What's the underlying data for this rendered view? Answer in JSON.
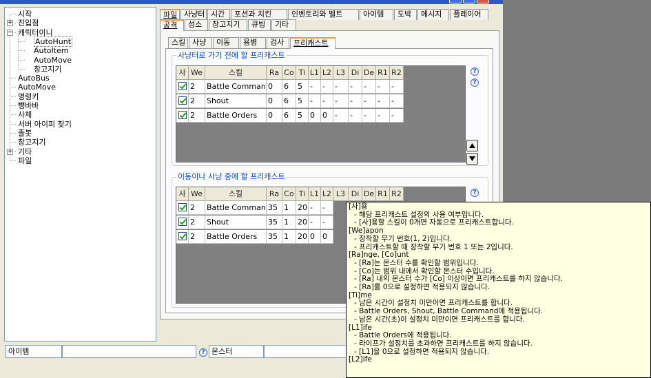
{
  "tree": {
    "items": [
      {
        "label": "시작",
        "level": 0,
        "exp": ""
      },
      {
        "label": "진입점",
        "level": 0,
        "exp": "+"
      },
      {
        "label": "캐릭터이니",
        "level": 0,
        "exp": "-"
      },
      {
        "label": "AutoHunt",
        "level": 1,
        "exp": "",
        "selected": true
      },
      {
        "label": "AutoItem",
        "level": 1,
        "exp": ""
      },
      {
        "label": "AutoMove",
        "level": 1,
        "exp": ""
      },
      {
        "label": "창고지기",
        "level": 1,
        "exp": ""
      },
      {
        "label": "AutoBus",
        "level": 0,
        "exp": ""
      },
      {
        "label": "AutoMove",
        "level": 0,
        "exp": ""
      },
      {
        "label": "명령키",
        "level": 0,
        "exp": ""
      },
      {
        "label": "뺑바바",
        "level": 0,
        "exp": ""
      },
      {
        "label": "사체",
        "level": 0,
        "exp": ""
      },
      {
        "label": "서버 아이피 찾기",
        "level": 0,
        "exp": ""
      },
      {
        "label": "졸봇",
        "level": 0,
        "exp": ""
      },
      {
        "label": "창고지기",
        "level": 0,
        "exp": ""
      },
      {
        "label": "기타",
        "level": 0,
        "exp": "+"
      },
      {
        "label": "파일",
        "level": 0,
        "exp": ""
      }
    ]
  },
  "tabs_row1": [
    "파일",
    "사냥터",
    "시간",
    "포션과 치킨",
    "인벤토리와 벨트",
    "아이템",
    "도박",
    "메시지",
    "플레이어"
  ],
  "tabs_row2": [
    "공격",
    "성소",
    "창고지기",
    "큐빙",
    "기타"
  ],
  "subtabs": [
    "스킬",
    "사냥",
    "이동",
    "용병",
    "검사",
    "프리캐스트"
  ],
  "groups": {
    "pre": {
      "label": "사냥터로 가기 전에 할 프리캐스트"
    },
    "move": {
      "label": "이동이나 사냥 중에 할 프리캐스트"
    }
  },
  "columns": [
    "사",
    "We",
    "스킬",
    "Ra",
    "Co",
    "Ti",
    "L1",
    "L2",
    "L3",
    "Di",
    "De",
    "R1",
    "R2"
  ],
  "grid_pre": [
    [
      "✓",
      "2",
      "Battle Command",
      "0",
      "6",
      "5",
      "-",
      "-",
      "-",
      "-",
      "-",
      "-",
      "-"
    ],
    [
      "✓",
      "2",
      "Shout",
      "0",
      "6",
      "5",
      "-",
      "-",
      "-",
      "-",
      "-",
      "-",
      "-"
    ],
    [
      "✓",
      "2",
      "Battle Orders",
      "0",
      "6",
      "5",
      "0",
      "0",
      "-",
      "-",
      "-",
      "-",
      "-"
    ]
  ],
  "grid_move": [
    [
      "✓",
      "2",
      "Battle Command",
      "35",
      "1",
      "20",
      "-",
      "-"
    ],
    [
      "✓",
      "2",
      "Shout",
      "35",
      "1",
      "20",
      "-",
      "-"
    ],
    [
      "✓",
      "2",
      "Battle Orders",
      "35",
      "1",
      "20",
      "0",
      "0"
    ]
  ],
  "status": {
    "item_label": "아이템",
    "monster_label": "몬스터"
  },
  "tooltip": [
    {
      "t": "[사]용",
      "i": false
    },
    {
      "t": "- 해당 프리캐스트 설정의 사용 여부입니다.",
      "i": true
    },
    {
      "t": "- [사]용할 스킬이 0개면 자동으로 프리캐스트합니다.",
      "i": true
    },
    {
      "t": "[We]apon",
      "i": false
    },
    {
      "t": "- 장착할 무기 번호(1, 2)입니다.",
      "i": true
    },
    {
      "t": "- 프리캐스트할 때 장착할 무기 번호 1 또는 2입니다.",
      "i": true
    },
    {
      "t": "[Ra]nge, [Co]unt",
      "i": false
    },
    {
      "t": "- [Ra]는 몬스터 수를 확인할 범위입니다.",
      "i": true
    },
    {
      "t": "- [Co]는 범위 내에서 확인할 몬스터 수입니다.",
      "i": true
    },
    {
      "t": "- [Ra] 내의 몬스터 수가 [Co] 이상이면 프리캐스트를 하지 않습니다.",
      "i": true
    },
    {
      "t": "- [Ra]를 0으로 설정하면 적용되지 않습니다.",
      "i": true
    },
    {
      "t": "[Ti]me",
      "i": false
    },
    {
      "t": "- 남은 시간이 설정치 미만이면 프리캐스트를 합니다.",
      "i": true
    },
    {
      "t": "- Battle Orders, Shout, Battle Command에 적용됩니다.",
      "i": true
    },
    {
      "t": "- 남은 시간(초)이 설정치 미만이면 프리캐스트를 합니다.",
      "i": true
    },
    {
      "t": "[L1]ife",
      "i": false
    },
    {
      "t": "- Battle Orders에 적용됩니다.",
      "i": true
    },
    {
      "t": "- 라이프가 설정치를 초과하면 프리캐스트를 하지 않습니다.",
      "i": true
    },
    {
      "t": "- [L1]을 0으로 설정하면 적용되지 않습니다.",
      "i": true
    },
    {
      "t": "[L2]ife",
      "i": false
    }
  ]
}
